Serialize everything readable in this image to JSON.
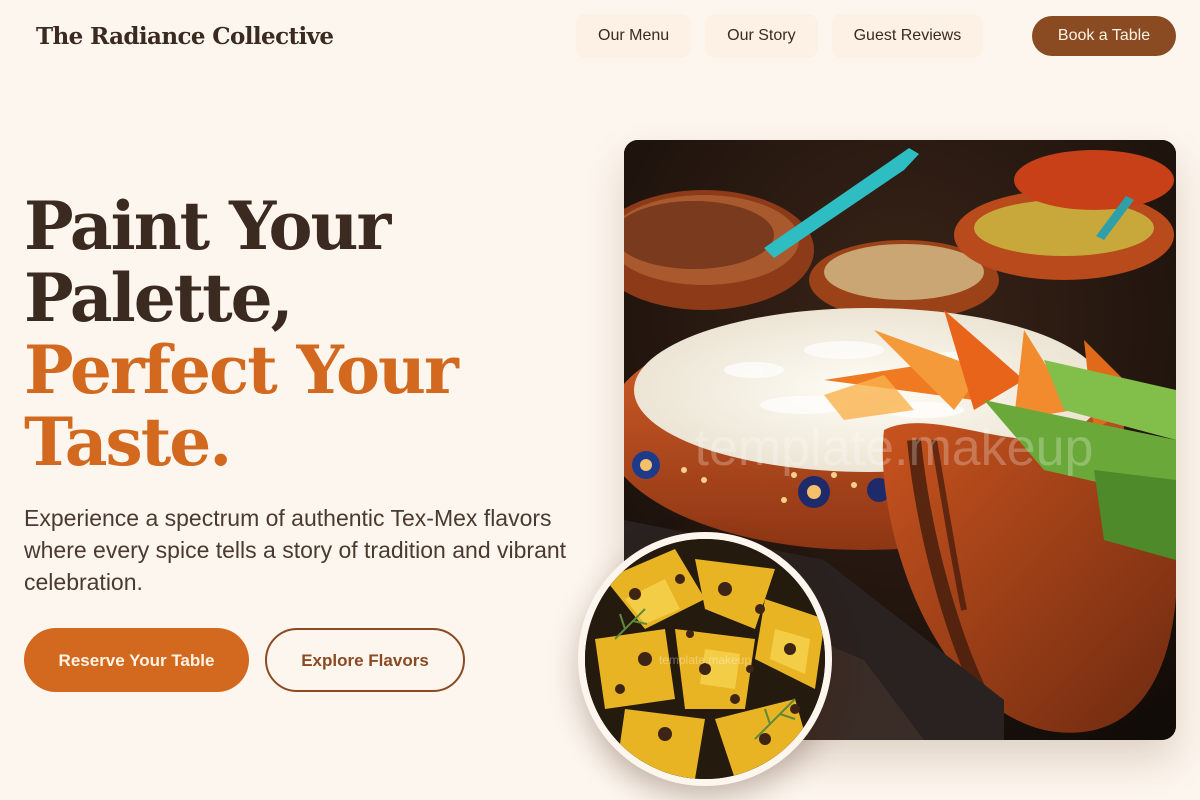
{
  "header": {
    "brand": "The Radiance Collective",
    "nav": [
      {
        "label": "Our Menu"
      },
      {
        "label": "Our Story"
      },
      {
        "label": "Guest Reviews"
      }
    ],
    "cta_label": "Book a Table"
  },
  "hero": {
    "headline_line1": "Paint Your",
    "headline_line2": "Palette,",
    "headline_line3": "Perfect Your",
    "headline_line4": "Taste.",
    "subtext": "Experience a spectrum of authentic Tex-Mex flavors where every spice tells a story of tradition and vibrant celebration.",
    "primary_button": "Reserve Your Table",
    "secondary_button": "Explore Flavors"
  },
  "images": {
    "main_watermark": "template.makeup",
    "inset_watermark": "template.makeup"
  },
  "colors": {
    "background": "#FDF6EE",
    "text_dark": "#3A2A20",
    "accent_orange": "#D2691E",
    "accent_brown": "#8A4A22"
  }
}
